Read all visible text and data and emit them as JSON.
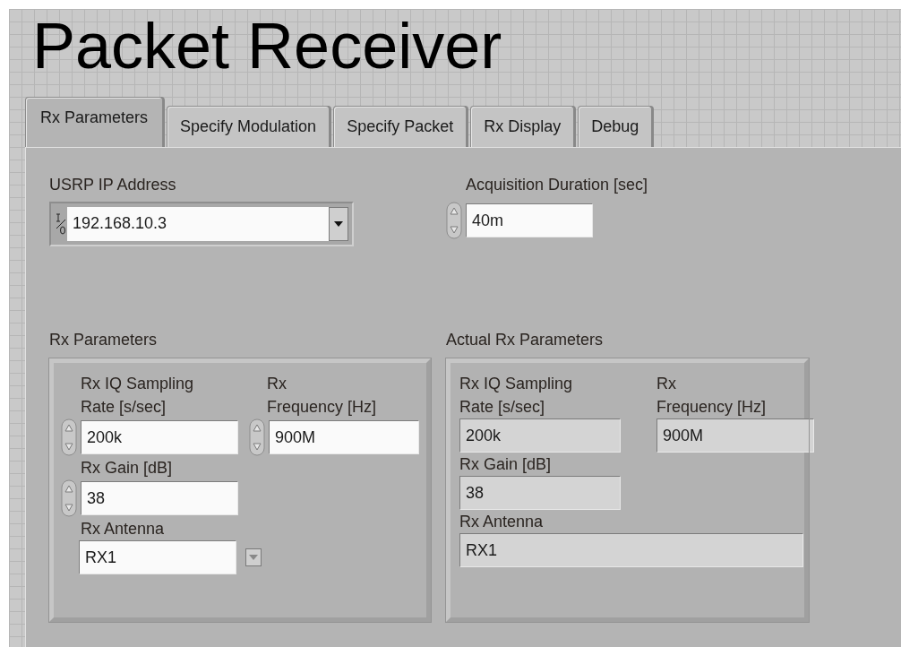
{
  "title": "Packet Receiver",
  "tabs": [
    {
      "label": "Rx Parameters",
      "selected": true
    },
    {
      "label": "Specify Modulation",
      "selected": false
    },
    {
      "label": "Specify Packet",
      "selected": false
    },
    {
      "label": "Rx Display",
      "selected": false
    },
    {
      "label": "Debug",
      "selected": false
    }
  ],
  "ip_address": {
    "label": "USRP IP Address",
    "value": "192.168.10.3"
  },
  "acquisition_duration": {
    "label": "Acquisition Duration [sec]",
    "value": "40m"
  },
  "clusters": [
    {
      "title": "Rx Parameters",
      "kind": "control",
      "sampling_rate": {
        "label": "Rx IQ Sampling\nRate [s/sec]",
        "value": "200k"
      },
      "frequency": {
        "label": "Rx\nFrequency [Hz]",
        "value": "900M"
      },
      "gain": {
        "label": "Rx Gain [dB]",
        "value": "38"
      },
      "antenna": {
        "label": "Rx Antenna",
        "value": "RX1"
      }
    },
    {
      "title": "Actual Rx Parameters",
      "kind": "indicator",
      "sampling_rate": {
        "label": "Rx IQ Sampling\nRate [s/sec]",
        "value": "200k"
      },
      "frequency": {
        "label": "Rx\nFrequency [Hz]",
        "value": "900M"
      },
      "gain": {
        "label": "Rx Gain [dB]",
        "value": "38"
      },
      "antenna": {
        "label": "Rx Antenna",
        "value": "RX1"
      }
    }
  ]
}
